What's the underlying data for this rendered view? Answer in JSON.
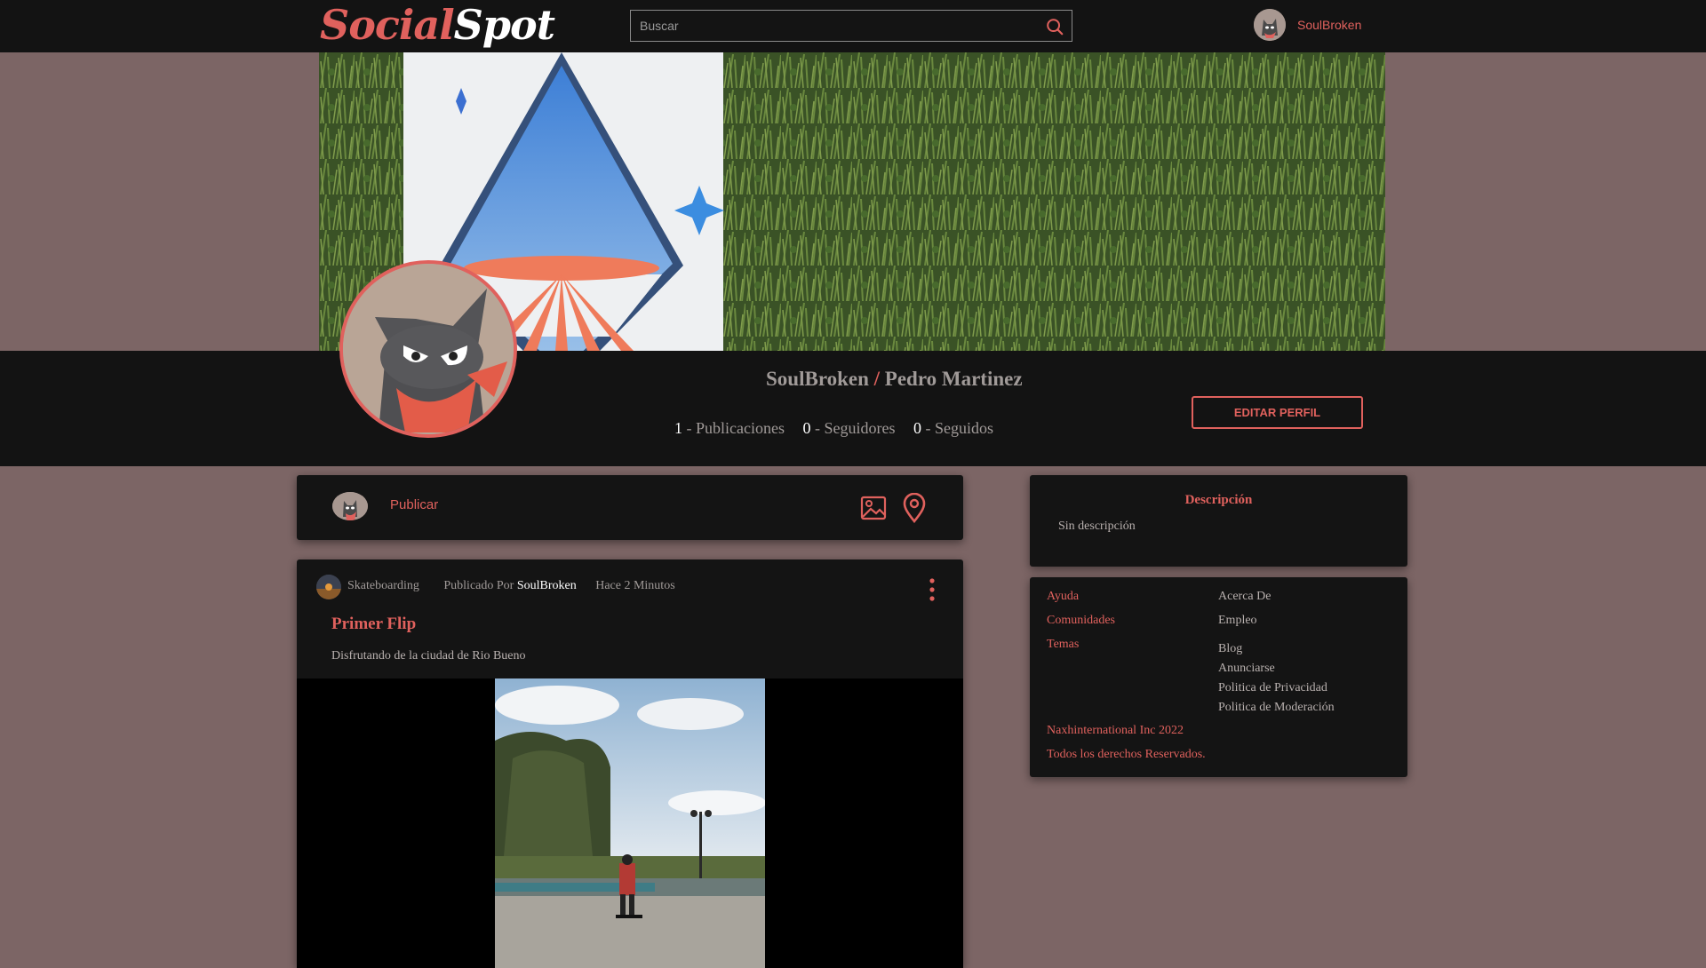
{
  "header": {
    "logo_part1": "Social",
    "logo_part2": "Spot",
    "search_placeholder": "Buscar",
    "username": "SoulBroken"
  },
  "profile": {
    "username": "SoulBroken",
    "separator": "/",
    "full_name": "Pedro Martinez",
    "stats": [
      {
        "count": "1",
        "label": "- Publicaciones"
      },
      {
        "count": "0",
        "label": "- Seguidores"
      },
      {
        "count": "0",
        "label": "- Seguidos"
      }
    ],
    "edit_button": "EDITAR PERFIL"
  },
  "composer": {
    "publish_label": "Publicar"
  },
  "post": {
    "community": "Skateboarding",
    "published_by": "Publicado Por",
    "author": "SoulBroken",
    "time": "Hace 2 Minutos",
    "title": "Primer Flip",
    "description": "Disfrutando de la ciudad de Rio Bueno"
  },
  "sidebar": {
    "description_title": "Descripción",
    "description_text": "Sin descripción",
    "left_links": [
      "Ayuda",
      "Comunidades",
      "Temas"
    ],
    "right_links": [
      "Acerca De",
      "Empleo",
      "Blog",
      "Anunciarse",
      "Politica de Privacidad",
      "Politica de Moderación"
    ],
    "company": "Naxhinternational Inc 2022",
    "rights": "Todos los derechos Reservados."
  },
  "colors": {
    "accent": "#e0615d",
    "background": "#7c6565",
    "panel": "#141414"
  }
}
